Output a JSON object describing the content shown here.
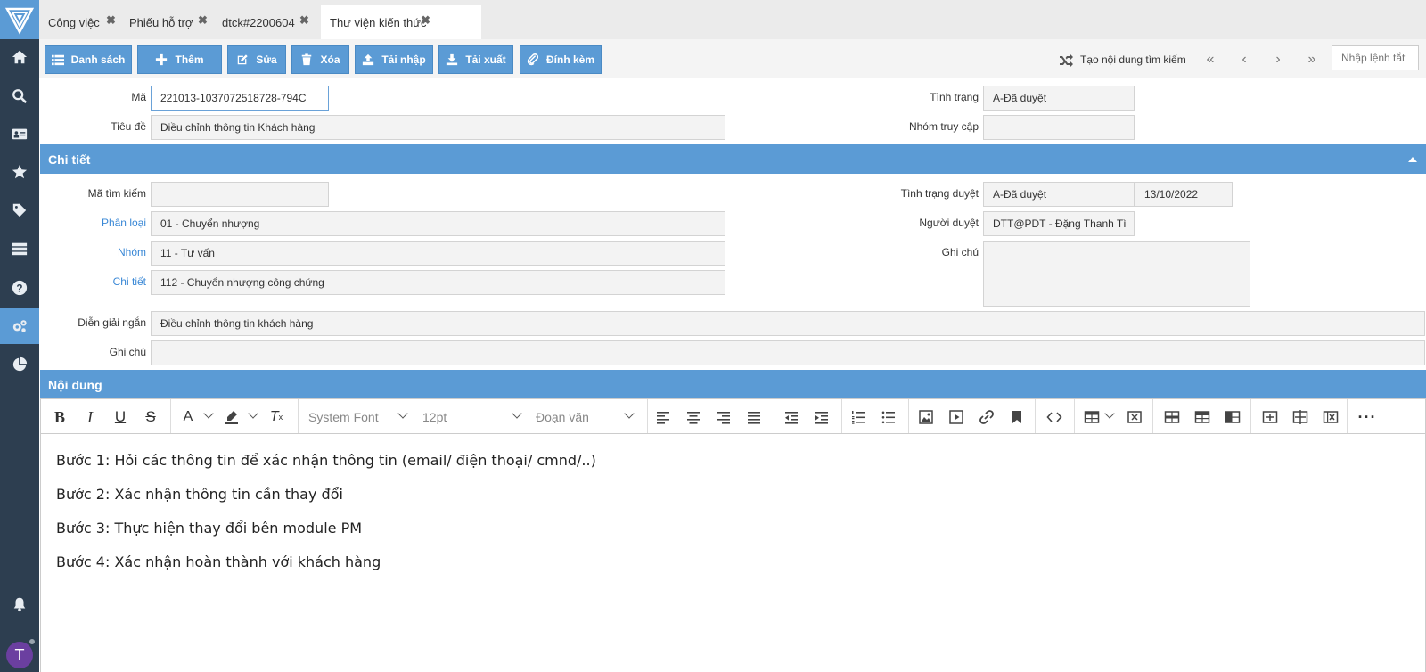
{
  "app": {
    "avatar_letter": "T"
  },
  "tabs": [
    {
      "label": "Công việc"
    },
    {
      "label": "Phiếu hỗ trợ"
    },
    {
      "label": "dtck#2200604"
    },
    {
      "label": "Thư viện kiến thức"
    }
  ],
  "toolbar": {
    "list": "Danh sách",
    "add": "Thêm",
    "edit": "Sửa",
    "delete": "Xóa",
    "import": "Tải nhập",
    "export": "Tải xuất",
    "attach": "Đính kèm",
    "search_content": "Tạo nội dung tìm kiếm",
    "cmd_placeholder": "Nhập lệnh tắt"
  },
  "header": {
    "ma_label": "Mã",
    "ma_value": "221013-1037072518728-794C",
    "tieude_label": "Tiêu đề",
    "tieude_value": "Điều chỉnh thông tin Khách hàng",
    "tinhtrang_label": "Tình trạng",
    "tinhtrang_value": "A-Đã duyệt",
    "nhom_truycap_label": "Nhóm truy cập",
    "nhom_truycap_value": ""
  },
  "chitiet": {
    "title": "Chi tiết",
    "ma_timkiem_label": "Mã tìm kiếm",
    "ma_timkiem_value": "",
    "phanloai_label": "Phân loại",
    "phanloai_value": "01 - Chuyển nhượng",
    "nhom_label": "Nhóm",
    "nhom_value": "11 - Tư vấn",
    "chitiet_label": "Chi tiết",
    "chitiet_value": "112 - Chuyển nhượng công chứng",
    "tinhtrang_duyet_label": "Tình trạng duyệt",
    "tinhtrang_duyet_value": "A-Đã duyệt",
    "ngay_duyet": "13/10/2022",
    "nguoi_duyet_label": "Người duyệt",
    "nguoi_duyet_value": "DTT@PDT - Đặng Thanh Tì",
    "ghichu_label": "Ghi chú",
    "ghichu_value": "",
    "diengiai_label": "Diễn giải ngắn",
    "diengiai_value": "Điều chỉnh thông tin khách hàng",
    "ghichu2_label": "Ghi chú",
    "ghichu2_value": ""
  },
  "noidung": {
    "title": "Nội dung",
    "font": "System Font",
    "size": "12pt",
    "block": "Đoạn văn",
    "paragraphs": [
      "Bước 1: Hỏi các thông tin để xác nhận thông tin (email/ điện thoại/ cmnd/..)",
      "Bước 2: Xác nhận thông tin cần thay đổi",
      "Bước 3: Thực hiện thay đổi bên module PM",
      "Bước 4: Xác nhận hoàn thành với khách hàng"
    ]
  },
  "colors": {
    "accent": "#5b9bd5",
    "sidebar": "#2d3e50",
    "link": "#3a88d6"
  }
}
